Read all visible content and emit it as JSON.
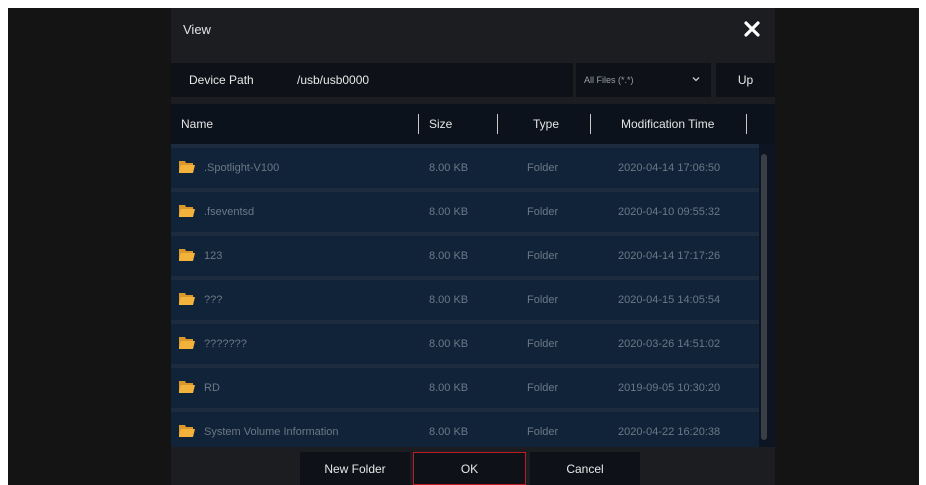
{
  "dialog": {
    "title": "View",
    "close_icon": "close-icon"
  },
  "path": {
    "label": "Device Path",
    "value": "/usb/usb0000",
    "filter_selected": "All Files (*.*)",
    "up_label": "Up"
  },
  "table": {
    "headers": {
      "name": "Name",
      "size": "Size",
      "type": "Type",
      "modified": "Modification Time"
    },
    "rows": [
      {
        "name": ".Spotlight-V100",
        "size": "8.00 KB",
        "type": "Folder",
        "modified": "2020-04-14 17:06:50"
      },
      {
        "name": ".fseventsd",
        "size": "8.00 KB",
        "type": "Folder",
        "modified": "2020-04-10 09:55:32"
      },
      {
        "name": "123",
        "size": "8.00 KB",
        "type": "Folder",
        "modified": "2020-04-14 17:17:26"
      },
      {
        "name": "???",
        "size": "8.00 KB",
        "type": "Folder",
        "modified": "2020-04-15 14:05:54"
      },
      {
        "name": "???????",
        "size": "8.00 KB",
        "type": "Folder",
        "modified": "2020-03-26 14:51:02"
      },
      {
        "name": "RD",
        "size": "8.00 KB",
        "type": "Folder",
        "modified": "2019-09-05 10:30:20"
      },
      {
        "name": "System Volume Information",
        "size": "8.00 KB",
        "type": "Folder",
        "modified": "2020-04-22 16:20:38"
      }
    ]
  },
  "footer": {
    "new_folder": "New Folder",
    "ok": "OK",
    "cancel": "Cancel"
  },
  "colors": {
    "folder": "#f2b33d",
    "ok_border": "#c01a24"
  }
}
